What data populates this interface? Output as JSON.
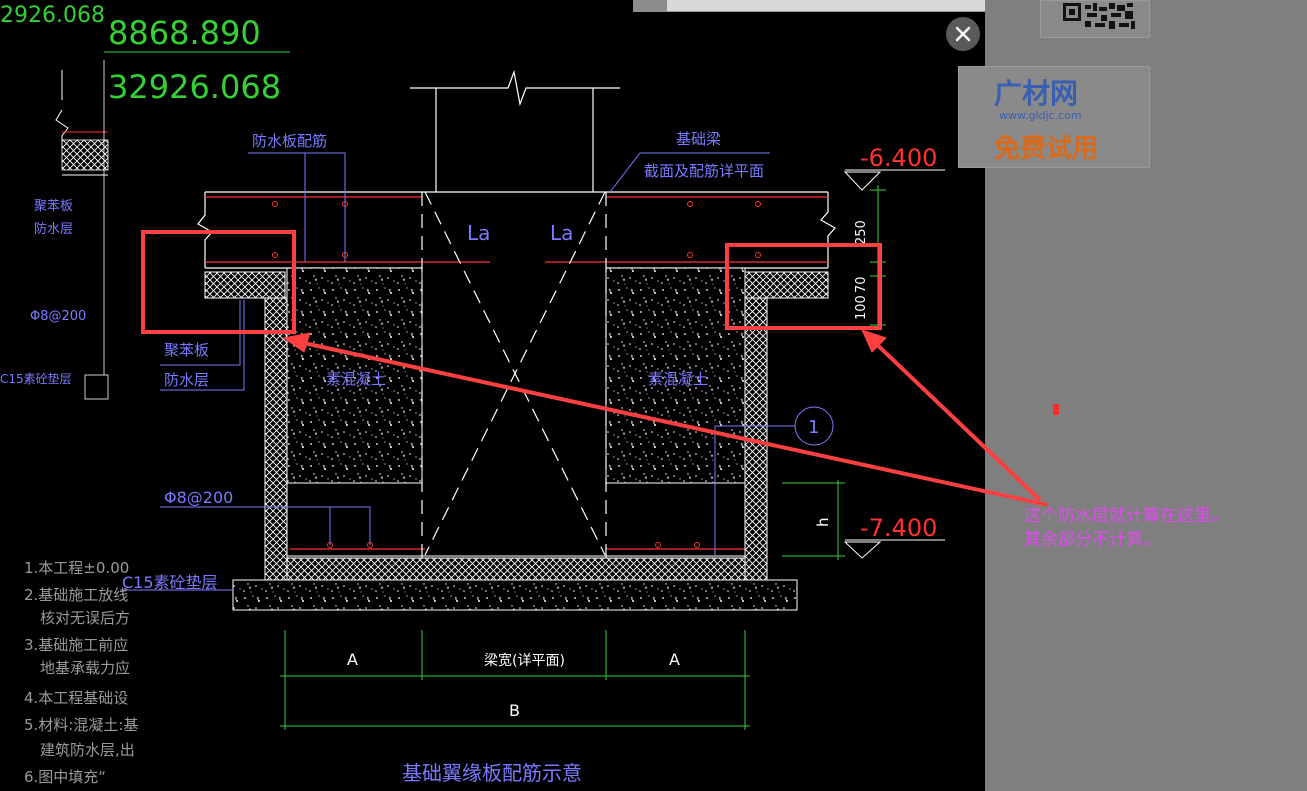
{
  "drawing": {
    "elevation_top_1": "8868.890",
    "elevation_top_2": "32926.068",
    "elevation_top_3": "2926.068",
    "elev_minus_6_4": "-6.400",
    "elev_minus_7_4": "-7.400",
    "dim_250": "250",
    "dim_70": "70",
    "dim_100": "100",
    "la_left": "La",
    "la_right": "La",
    "label_waterproof_rebar": "防水板配筋",
    "label_beam_1": "基础梁",
    "label_beam_2": "截面及配筋详平面",
    "label_polystyrene": "聚苯板",
    "label_waterproof_layer": "防水层",
    "label_plain_concrete_left": "素混凝土",
    "label_plain_concrete_right": "素混凝土",
    "label_rebar_spacing_top": "Φ8@200",
    "label_rebar_spacing_bottom": "Φ8@200",
    "label_c15_pad": "C15素砼垫层",
    "left_polystyrene": "聚苯板",
    "left_waterproof": "防水层",
    "left_phi8": "Φ8@200",
    "left_c15": "C15素砼垫层",
    "circle_marker": "1",
    "dim_h": "h",
    "dim_a_left": "A",
    "dim_beam_width": "梁宽(详平面)",
    "dim_a_right": "A",
    "dim_b": "B",
    "caption": "基础翼缘板配筋示意",
    "notes": [
      "1.本工程±0.00",
      "2.基础施工放线",
      "核对无误后方",
      "3.基础施工前应",
      "地基承载力应",
      "4.本工程基础设",
      "5.材料:混凝土:基",
      "建筑防水层,出",
      "6.图中填充“"
    ]
  },
  "annotation": {
    "line1": "这个防水层就计算在这里。",
    "line2": "其余部分不计算。"
  },
  "ad": {
    "brand": "广材网",
    "url": "www.gldjc.com",
    "promo": "免费试用"
  },
  "colors": {
    "cad_background": "#000000",
    "cad_line_white": "#ffffff",
    "cad_line_green": "#34d134",
    "cad_line_red": "#ff3030",
    "cad_text_blue": "#7a7aff",
    "annotation_red": "#ff4040",
    "annotation_text": "#e04cf0",
    "overlay_gray": "#7f7f7f"
  }
}
